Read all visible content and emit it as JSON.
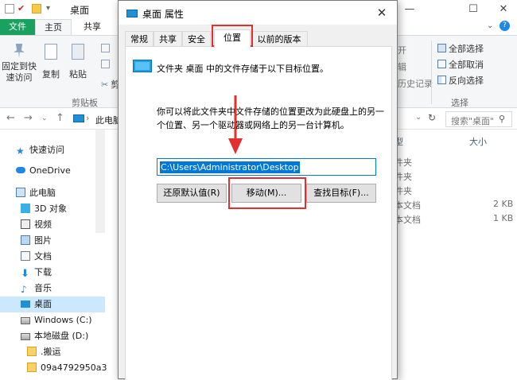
{
  "explorer": {
    "title": "桌面",
    "window_controls": {
      "minimize": "—",
      "maximize": "☐",
      "close": "✕"
    },
    "ribbon_tabs": {
      "file": "文件",
      "home": "主页",
      "share": "共享"
    },
    "ribbon": {
      "pin_quick_access": "固定到快速访问",
      "copy": "复制",
      "paste": "粘贴",
      "cut": "剪切",
      "clipboard_group": "剪贴板",
      "open_partial": "开",
      "edit_partial": "辑",
      "history_partial": "历史记录",
      "select_all": "全部选择",
      "select_none": "全部取消",
      "invert_selection": "反向选择",
      "select_group": "选择"
    },
    "address": {
      "path": "此电脑",
      "search_placeholder": "搜索\"桌面\""
    },
    "nav": {
      "quick_access": "快速访问",
      "onedrive": "OneDrive",
      "this_pc": "此电脑",
      "objects3d": "3D 对象",
      "videos": "视频",
      "pictures": "图片",
      "documents": "文档",
      "downloads": "下载",
      "music": "音乐",
      "desktop": "桌面",
      "windows_c": "Windows (C:)",
      "local_d": "本地磁盘 (D:)",
      "banyun": ".搬运",
      "hash_folder": "09a4792950a3"
    },
    "columns": {
      "type_partial": "型",
      "size": "大小"
    },
    "files": [
      {
        "type": "件夹",
        "size": ""
      },
      {
        "type": "件夹",
        "size": ""
      },
      {
        "type": "件夹",
        "size": ""
      },
      {
        "type": "本文档",
        "size": "2 KB"
      },
      {
        "type": "本文档",
        "size": "1 KB"
      }
    ]
  },
  "dialog": {
    "title": "桌面 属性",
    "close": "✕",
    "tabs": [
      "常规",
      "共享",
      "安全",
      "位置",
      "以前的版本"
    ],
    "active_tab": "位置",
    "info": "文件夹 桌面 中的文件存储于以下目标位置。",
    "description": "你可以将此文件夹中文件存储的位置更改为此硬盘上的另一个位置、另一个驱动器或网络上的另一台计算机。",
    "path_value": "C:\\Users\\Administrator\\Desktop",
    "buttons": {
      "restore": "还原默认值(R)",
      "move": "移动(M)...",
      "find_target": "查找目标(F)..."
    }
  },
  "colors": {
    "accent": "#0078d7",
    "annotation_red": "#e23030",
    "file_tab_green": "#19a15f",
    "folder_blue": "#1ea0ea"
  }
}
